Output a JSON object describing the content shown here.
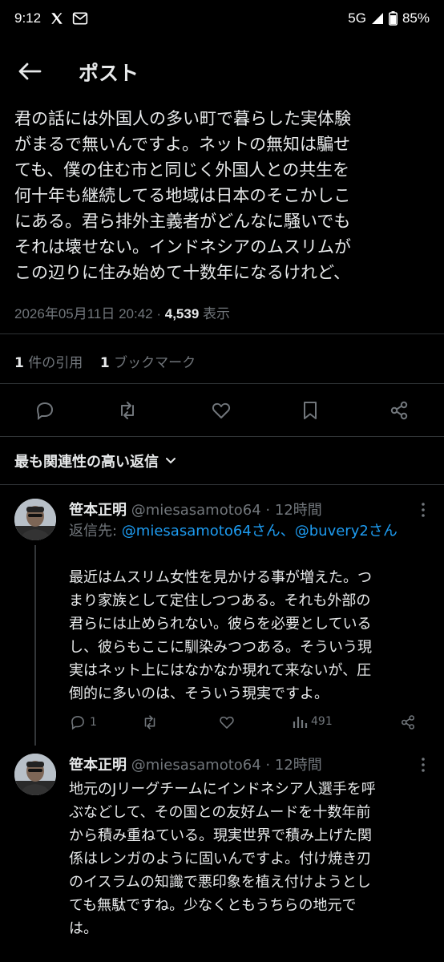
{
  "status_bar": {
    "time": "9:12",
    "network": "5G",
    "battery": "85%",
    "icons": [
      "x-logo-icon",
      "mail-icon",
      "signal-icon",
      "battery-icon"
    ]
  },
  "header": {
    "title": "ポスト"
  },
  "post": {
    "lines": [
      "君の話には外国人の多い町で暮らした実体験",
      "がまるで無いんですよ。ネットの無知は騙せ",
      "ても、僕の住む市と同じく外国人との共生を",
      "何十年も継続してる地域は日本のそこかしこ",
      "にある。君ら排外主義者がどんなに騒いでも",
      "それは壊せない。インドネシアのムスリムが",
      "この辺りに住み始めて十数年になるけれど、"
    ],
    "timestamp": "2026年05月11日 20:42",
    "separator": " · ",
    "views_count": "4,539",
    "views_label": "表示",
    "quotes_count": "1",
    "quotes_label": "件の引用",
    "bookmarks_count": "1",
    "bookmarks_label": "ブックマーク"
  },
  "actions": {
    "icons": [
      "reply-icon",
      "retweet-icon",
      "like-icon",
      "bookmark-icon",
      "share-icon"
    ]
  },
  "sort": {
    "label": "最も関連性の高い返信"
  },
  "replies": [
    {
      "name": "笹本正明",
      "handle": "@miesasamoto64",
      "time": "· 12時間",
      "reply_to_prefix": "返信先: ",
      "mention1": "@miesasamoto64さん",
      "mention_sep": "、",
      "mention2": "@buvery2さん",
      "lines": [
        "最近はムスリム女性を見かける事が増えた。つ",
        "まり家族として定住しつつある。それも外部の",
        "君らには止められない。彼らを必要としている",
        "し、彼らもここに馴染みつつある。そういう現",
        "実はネット上にはなかなか現れて来ないが、圧",
        "倒的に多いのは、そういう現実ですよ。"
      ],
      "reply_count": "1",
      "retweet_count": "",
      "like_count": "",
      "views_count": "491"
    },
    {
      "name": "笹本正明",
      "handle": "@miesasamoto64",
      "time": "· 12時間",
      "lines": [
        "地元のJリーグチームにインドネシア人選手を呼",
        "ぶなどして、その国との友好ムードを十数年前",
        "から積み重ねている。現実世界で積み上げた関",
        "係はレンガのように固いんですよ。付け焼き刃",
        "のイスラムの知識で悪印象を植え付けようとし",
        "ても無駄ですね。少なくともうちらの地元で",
        "は。"
      ]
    }
  ],
  "colors": {
    "background": "#000000",
    "text": "#e7e9ea",
    "muted": "#71767b",
    "link": "#1d9bf0",
    "divider": "#2f3336"
  }
}
